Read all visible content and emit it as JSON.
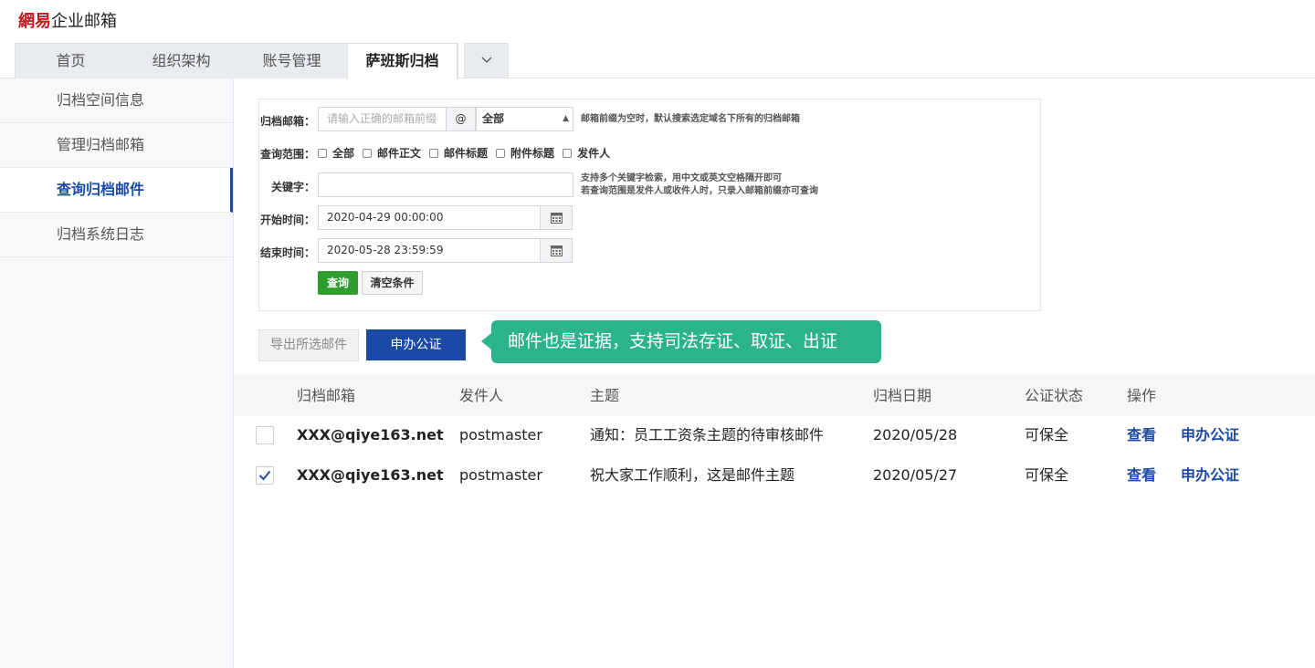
{
  "app": {
    "brand": "網易",
    "product": "企业邮箱"
  },
  "tabs": [
    "首页",
    "组织架构",
    "账号管理",
    "萨班斯归档"
  ],
  "tab_more_icon": "chevron-down-icon",
  "sidebar": {
    "items": [
      "归档空间信息",
      "管理归档邮箱",
      "查询归档邮件",
      "归档系统日志"
    ],
    "active": "查询归档邮件"
  },
  "search": {
    "mailbox_label": "归档邮箱：",
    "mailbox_placeholder": "请输入正确的邮箱前缀",
    "at": "@",
    "domain_value": "全部",
    "mailbox_hint": "邮箱前缀为空时，默认搜索选定域名下所有的归档邮箱",
    "scope_label": "查询范围：",
    "scope_options": [
      "全部",
      "邮件正文",
      "邮件标题",
      "附件标题",
      "发件人"
    ],
    "keyword_label": "关键字：",
    "keyword_value": "",
    "keyword_hint_1": "支持多个关键字检索，用中文或英文空格隔开即可",
    "keyword_hint_2": "若查询范围是发件人或收件人时，只录入邮箱前缀亦可查询",
    "start_label": "开始时间：",
    "start_value": "2020-04-29 00:00:00",
    "end_label": "结束时间：",
    "end_value": "2020-05-28 23:59:59",
    "query_button": "查询",
    "clear_button": "清空条件"
  },
  "actions": {
    "export": "导出所选邮件",
    "notary": "申办公证"
  },
  "callout": "邮件也是证据，支持司法存证、取证、出证",
  "table": {
    "headers": [
      "归档邮箱",
      "发件人",
      "主题",
      "归档日期",
      "公证状态",
      "操作"
    ],
    "rows": [
      {
        "checked": false,
        "mailbox": "XXX@qiye163.net",
        "sender": "postmaster",
        "subject": "通知：员工工资条主题的待审核邮件",
        "date": "2020/05/28",
        "status": "可保全",
        "view": "查看",
        "apply": "申办公证"
      },
      {
        "checked": true,
        "mailbox": "XXX@qiye163.net",
        "sender": "postmaster",
        "subject": "祝大家工作顺利，这是邮件主题",
        "date": "2020/05/27",
        "status": "可保全",
        "view": "查看",
        "apply": "申办公证"
      }
    ]
  },
  "colors": {
    "primary": "#1b4aa6",
    "green_button": "#2e9e2e",
    "callout": "#2db38c",
    "brand_red": "#c8161e"
  }
}
